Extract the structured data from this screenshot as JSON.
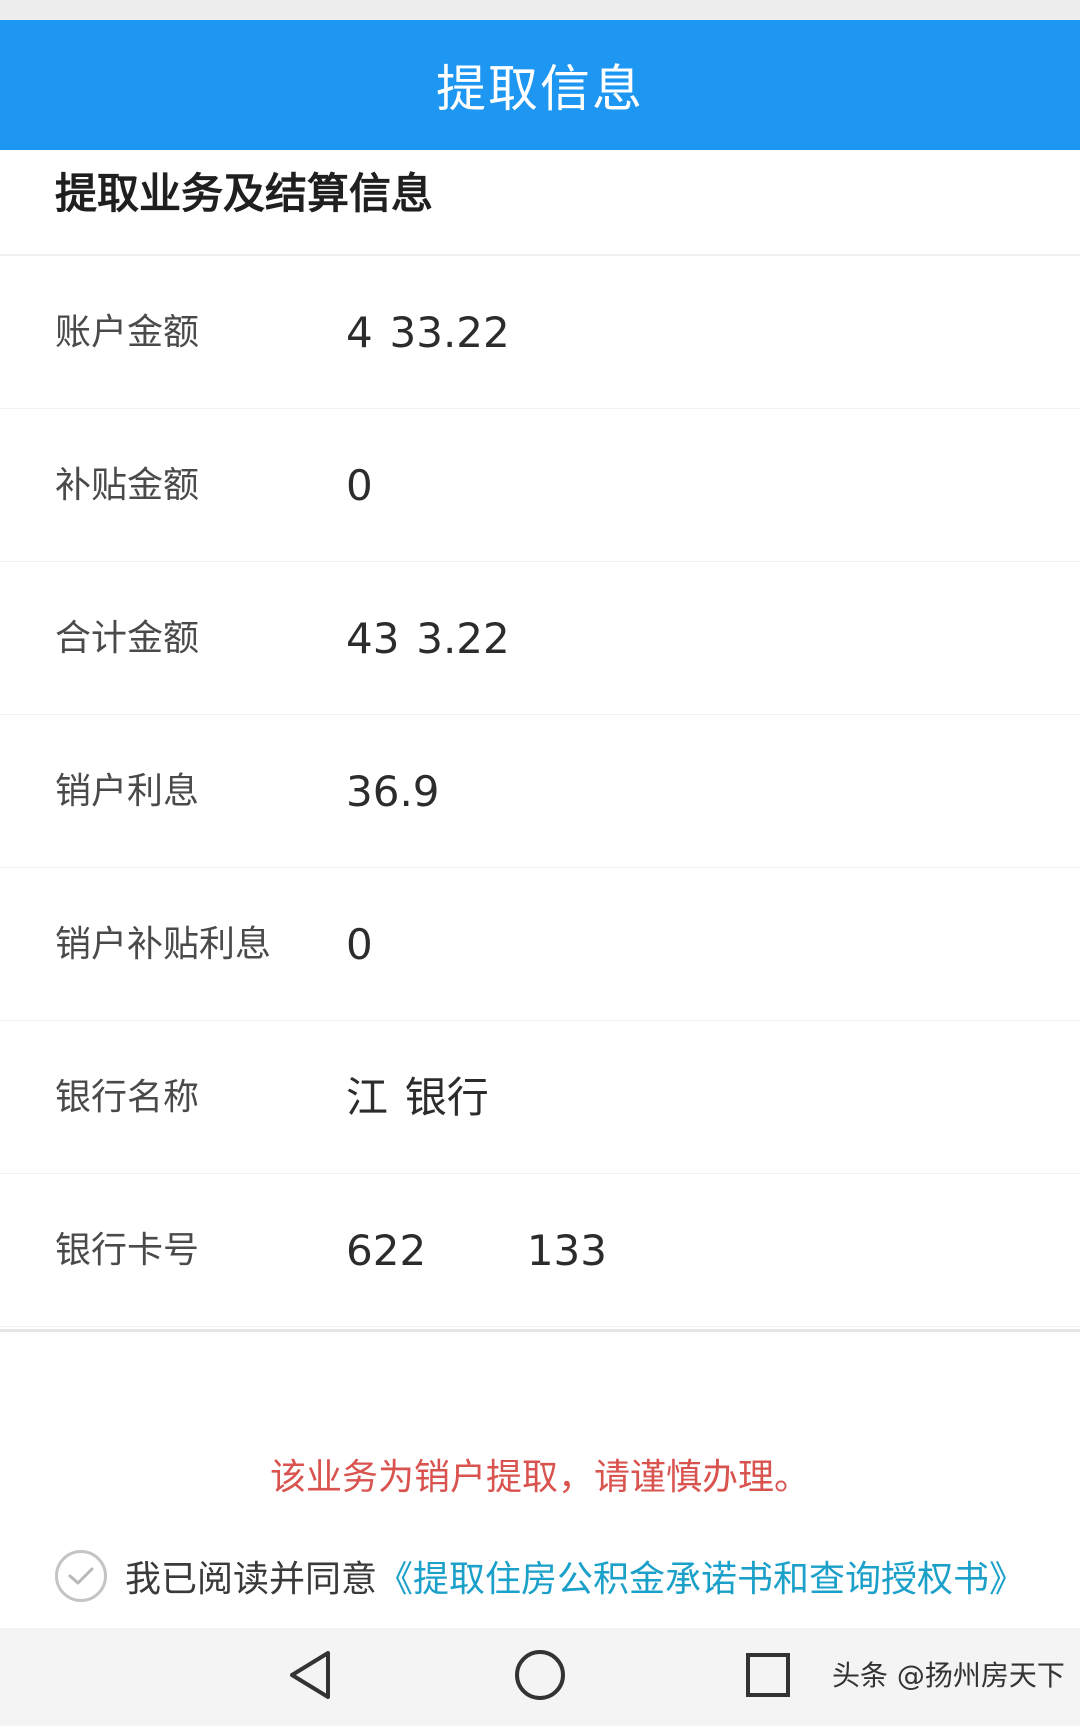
{
  "app_bar": {
    "title": "提取信息"
  },
  "section": {
    "title": "提取业务及结算信息"
  },
  "rows": [
    {
      "label": "账户金额",
      "value": "4  33.22"
    },
    {
      "label": "补贴金额",
      "value": "0"
    },
    {
      "label": "合计金额",
      "value": "43  3.22"
    },
    {
      "label": "销户利息",
      "value": "36.9"
    },
    {
      "label": "销户补贴利息",
      "value": "0"
    },
    {
      "label": "银行名称",
      "value": "江  银行"
    },
    {
      "label": "银行卡号",
      "value": "622            133"
    }
  ],
  "warning": "该业务为销户提取，请谨慎办理。",
  "agreement": {
    "prefix": "我已阅读并同意",
    "link": "《提取住房公积金承诺书和查询授权书》"
  },
  "watermark": "头条 @扬州房天下",
  "colors": {
    "app_bar": "#1e97f3",
    "warning": "#d9534f",
    "link": "#1aa0c9"
  },
  "icons": [
    "check-circle-icon",
    "back-triangle-icon",
    "home-circle-icon",
    "recents-square-icon"
  ]
}
